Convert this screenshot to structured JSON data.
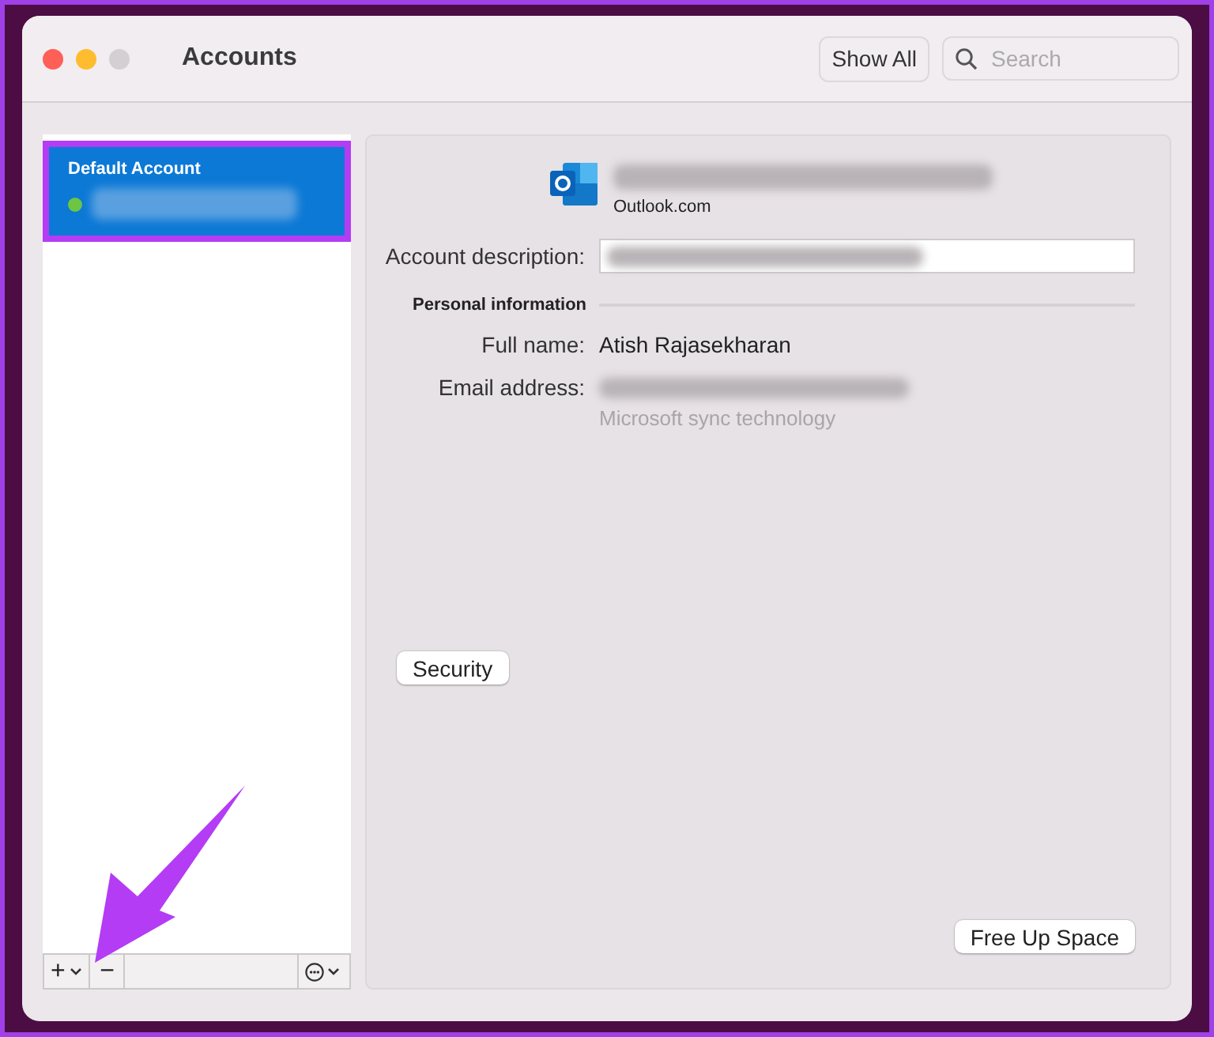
{
  "window": {
    "title": "Accounts"
  },
  "toolbar": {
    "show_all": "Show All",
    "search": {
      "placeholder": "Search"
    }
  },
  "accounts": [
    {
      "name": "Default Account",
      "selected": true,
      "color": "#6cc644"
    }
  ],
  "sidebar_footer": {
    "add": "+",
    "remove": "−"
  },
  "detail": {
    "provider": "Outlook.com",
    "description_label": "Account description:",
    "section": "Personal information",
    "fields": [
      {
        "label": "Full name:",
        "value": "Atish Rajasekharan",
        "kind": "text"
      },
      {
        "label": "Email address:",
        "kind": "redacted",
        "note": "Microsoft sync technology"
      }
    ],
    "security": "Security",
    "free_up_space": "Free Up Space"
  },
  "annotations": {
    "highlight": true,
    "arrow": true
  }
}
